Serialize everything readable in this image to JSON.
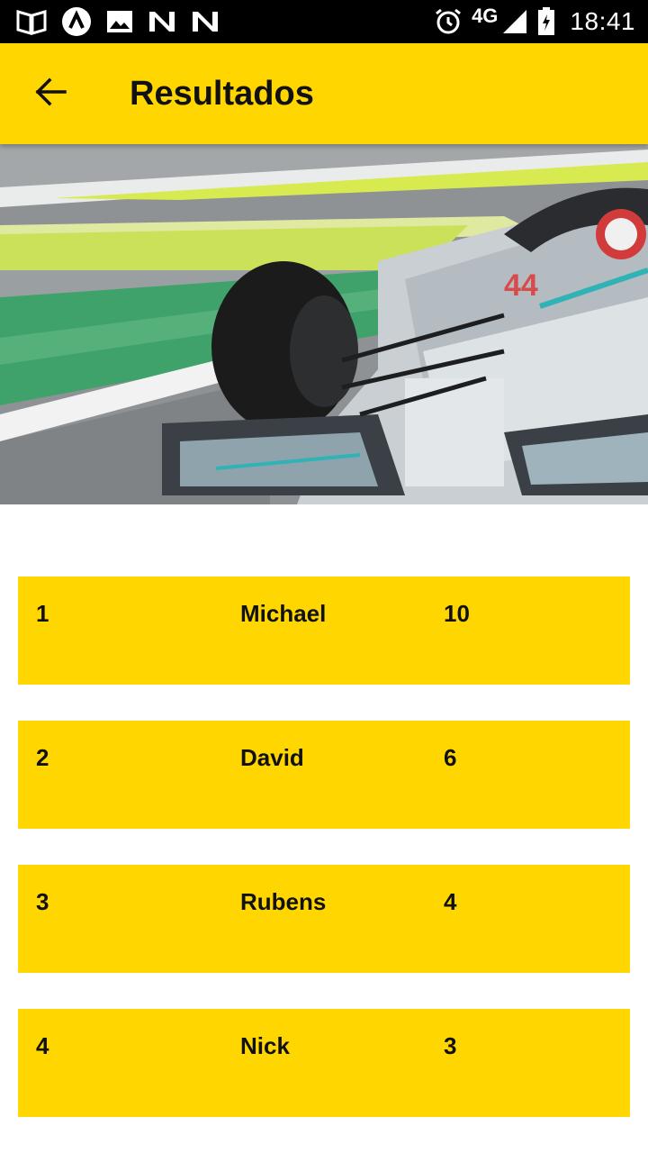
{
  "status_bar": {
    "left_icons": [
      "book-icon",
      "app-launcher-icon",
      "image-icon",
      "n-icon",
      "n-icon"
    ],
    "right_icons": [
      "alarm-icon",
      "signal-icon",
      "battery-icon"
    ],
    "network": "4G",
    "time": "18:41"
  },
  "app_bar": {
    "back_icon": "arrow-left-icon",
    "title": "Resultados",
    "background": "#FFD600"
  },
  "hero": {
    "description_icon": "formula-one-car-image",
    "car_number": "44"
  },
  "results": [
    {
      "position": "1",
      "name": "Michael",
      "points": "10"
    },
    {
      "position": "2",
      "name": "David",
      "points": "6"
    },
    {
      "position": "3",
      "name": "Rubens",
      "points": "4"
    },
    {
      "position": "4",
      "name": "Nick",
      "points": "3"
    }
  ],
  "colors": {
    "accent": "#FFD600",
    "text": "#111111",
    "status_bar": "#000000"
  }
}
